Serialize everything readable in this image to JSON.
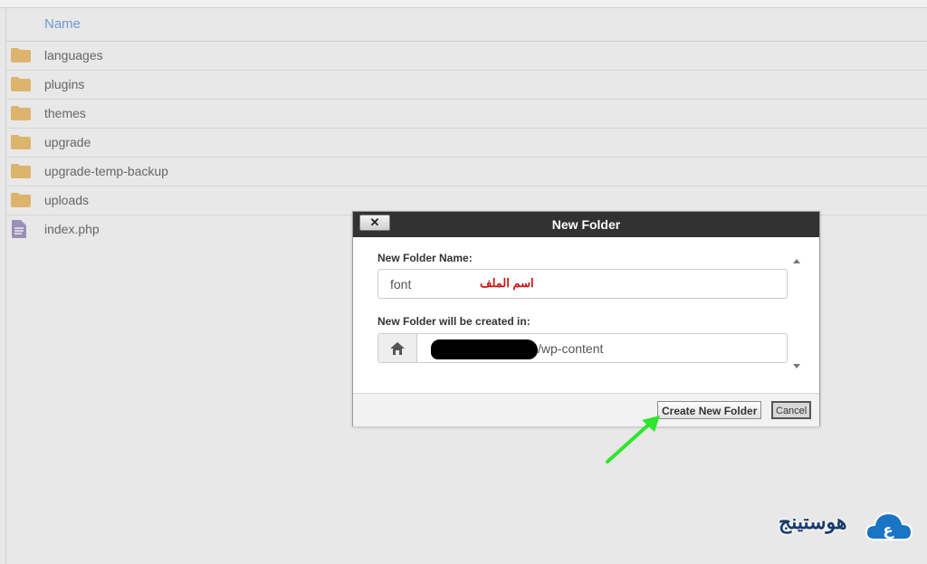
{
  "file_table": {
    "header": "Name",
    "rows": [
      {
        "name": "languages",
        "icon": "folder-icon"
      },
      {
        "name": "plugins",
        "icon": "folder-icon"
      },
      {
        "name": "themes",
        "icon": "folder-icon"
      },
      {
        "name": "upgrade",
        "icon": "folder-icon"
      },
      {
        "name": "upgrade-temp-backup",
        "icon": "folder-icon"
      },
      {
        "name": "uploads",
        "icon": "folder-icon"
      },
      {
        "name": "index.php",
        "icon": "file-icon"
      }
    ]
  },
  "dialog": {
    "title": "New Folder",
    "close_label": "✕",
    "name_label": "New Folder Name:",
    "name_value": "font",
    "name_annotation": "اسم الملف",
    "location_label": "New Folder will be created in:",
    "location_value": "/wp-content",
    "create_button": "Create New Folder",
    "cancel_button": "Cancel"
  },
  "watermark": {
    "text": "هوستينج",
    "logo_glyph": "ع"
  },
  "colors": {
    "folder": "#dcb46e",
    "file": "#9a8fb8",
    "header_text": "#6d9bd1",
    "arrow": "#2ee62e",
    "annotation": "#cc1111",
    "brand": "#1a75c4"
  }
}
